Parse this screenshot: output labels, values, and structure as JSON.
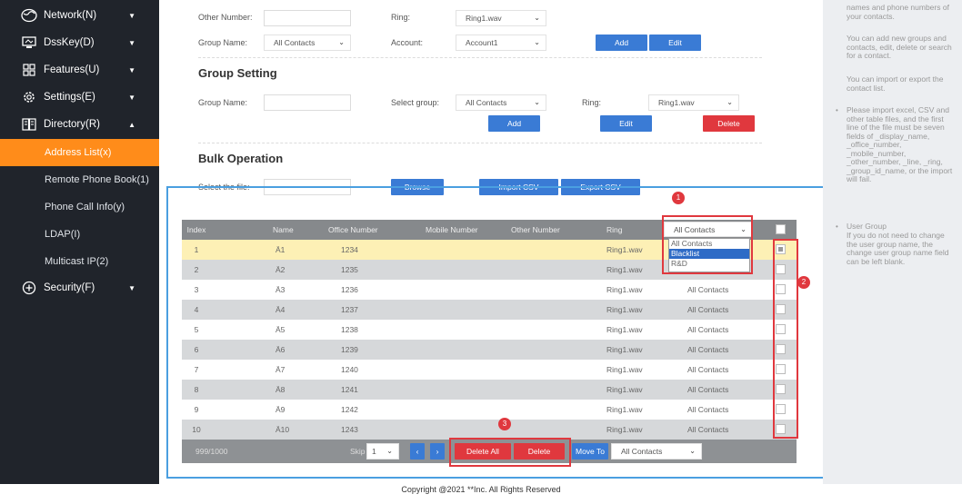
{
  "sidebar": {
    "items": [
      {
        "label": "Network(N)",
        "icon": "globe-icon",
        "caret": "▼"
      },
      {
        "label": "DssKey(D)",
        "icon": "monitor-icon",
        "caret": "▼"
      },
      {
        "label": "Features(U)",
        "icon": "grid-icon",
        "caret": "▼"
      },
      {
        "label": "Settings(E)",
        "icon": "gear-icon",
        "caret": "▼"
      },
      {
        "label": "Directory(R)",
        "icon": "book-icon",
        "caret": "▲"
      }
    ],
    "sub_items": [
      "Address List(x)",
      "Remote Phone Book(1)",
      "Phone Call Info(y)",
      "LDAP(I)",
      "Multicast IP(2)"
    ],
    "security": {
      "label": "Security(F)",
      "icon": "shield-plus-icon",
      "caret": "▼"
    }
  },
  "contact_form": {
    "other_number_label": "Other Number:",
    "ring_label": "Ring:",
    "ring_value": "Ring1.wav",
    "group_name_label": "Group Name:",
    "group_name_value": "All Contacts",
    "account_label": "Account:",
    "account_value": "Account1",
    "add_label": "Add",
    "edit_label": "Edit"
  },
  "group_setting": {
    "title": "Group Setting",
    "group_name_label": "Group Name:",
    "select_group_label": "Select group:",
    "select_group_value": "All Contacts",
    "ring_label": "Ring:",
    "ring_value": "Ring1.wav",
    "add_label": "Add",
    "edit_label": "Edit",
    "delete_label": "Delete"
  },
  "bulk": {
    "title": "Bulk Operation",
    "select_file_label": "Select the file:",
    "browse_label": "Browse",
    "import_label": "Import CSV",
    "export_label": "Export CSV"
  },
  "table": {
    "headers": [
      "Index",
      "Name",
      "Office Number",
      "Mobile Number",
      "Other Number",
      "Ring"
    ],
    "group_filter": "All Contacts",
    "filter_options": [
      "All Contacts",
      "Blacklist",
      "R&D"
    ],
    "rows": [
      {
        "index": "1",
        "name": "Ä1",
        "office": "1234",
        "ring": "Ring1.wav",
        "group": ""
      },
      {
        "index": "2",
        "name": "Ä2",
        "office": "1235",
        "ring": "Ring1.wav",
        "group": ""
      },
      {
        "index": "3",
        "name": "Ä3",
        "office": "1236",
        "ring": "Ring1.wav",
        "group": "All Contacts"
      },
      {
        "index": "4",
        "name": "Ä4",
        "office": "1237",
        "ring": "Ring1.wav",
        "group": "All Contacts"
      },
      {
        "index": "5",
        "name": "Ä5",
        "office": "1238",
        "ring": "Ring1.wav",
        "group": "All Contacts"
      },
      {
        "index": "6",
        "name": "Ä6",
        "office": "1239",
        "ring": "Ring1.wav",
        "group": "All Contacts"
      },
      {
        "index": "7",
        "name": "Ä7",
        "office": "1240",
        "ring": "Ring1.wav",
        "group": "All Contacts"
      },
      {
        "index": "8",
        "name": "Ä8",
        "office": "1241",
        "ring": "Ring1.wav",
        "group": "All Contacts"
      },
      {
        "index": "9",
        "name": "Ä9",
        "office": "1242",
        "ring": "Ring1.wav",
        "group": "All Contacts"
      },
      {
        "index": "10",
        "name": "Ä10",
        "office": "1243",
        "ring": "Ring1.wav",
        "group": "All Contacts"
      }
    ],
    "footer": {
      "count": "999/1000",
      "skip_label": "Skip to",
      "page_value": "1",
      "prev": "‹",
      "next": "›",
      "delete_all_label": "Delete All",
      "delete_label": "Delete",
      "move_to_label": "Move To",
      "move_to_value": "All Contacts"
    }
  },
  "annotations": {
    "badge1": "1",
    "badge2": "2",
    "badge3": "3"
  },
  "help": {
    "p1": "names and phone numbers of your contacts.",
    "p2": "You can add new groups and contacts, edit, delete or search for a contact.",
    "p3": "You can import or export the contact list.",
    "p4": "Please import excel, CSV and other table files, and the first line of the file must be seven fields of _display_name, _office_number, _mobile_number, _other_number, _line, _ring, _group_id_name, or the import will fail.",
    "p5": "User Group",
    "p6": "If you do not need to change the user group name, the change user group name field can be left blank."
  },
  "footer": {
    "copyright": "Copyright @2021 **Inc. All Rights Reserved"
  },
  "colors": {
    "accent": "#ff8c1a",
    "sidebar": "#20242b",
    "primary": "#3a7bd5",
    "danger": "#e0383e",
    "highlight_row": "#fdf0b5"
  }
}
